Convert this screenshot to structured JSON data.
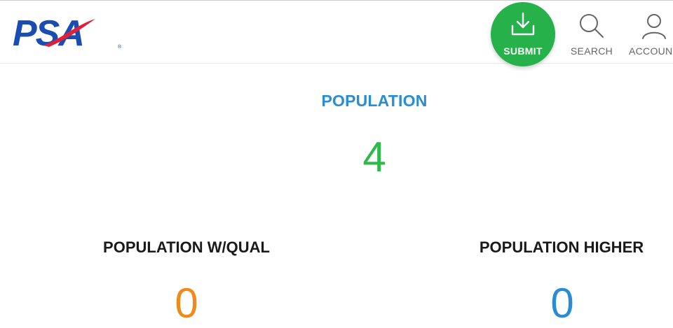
{
  "header": {
    "logo_text": "PSA",
    "submit_label": "SUBMIT",
    "search_label": "SEARCH",
    "account_label": "ACCOUNT",
    "icons": {
      "submit": "download-icon",
      "search": "search-icon",
      "account": "user-icon"
    }
  },
  "main": {
    "population": {
      "label": "POPULATION",
      "value": "4"
    },
    "population_qual": {
      "label": "POPULATION W/QUAL",
      "value": "0"
    },
    "population_higher": {
      "label": "POPULATION HIGHER",
      "value": "0"
    }
  },
  "colors": {
    "brand_blue": "#1a4db1",
    "brand_red": "#e21e38",
    "submit_green": "#26b14a",
    "population_title_blue": "#2a8dd4",
    "population_value_green": "#2fb84b",
    "qual_value_orange": "#ef8b1a",
    "higher_value_blue": "#2a8dd4"
  }
}
